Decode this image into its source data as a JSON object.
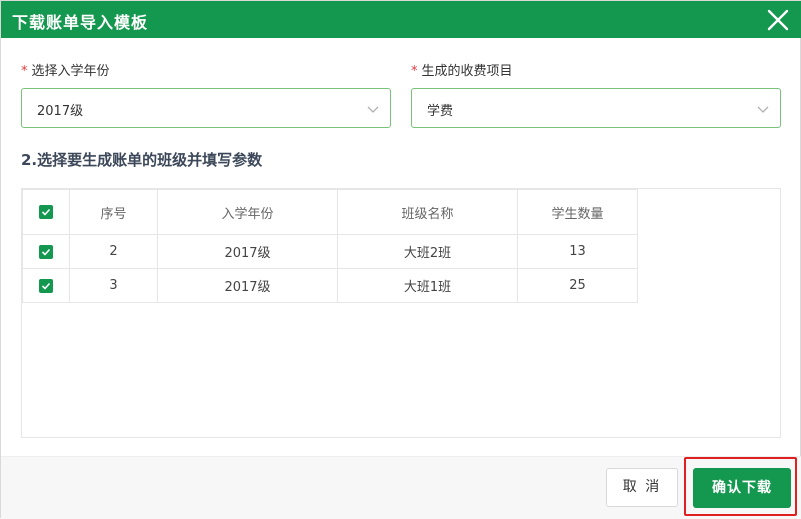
{
  "dialog": {
    "title": "下载账单导入模板",
    "close_icon": "close-icon"
  },
  "form": {
    "enroll_year": {
      "required_mark": "*",
      "label": "选择入学年份",
      "value": "2017级"
    },
    "fee_item": {
      "required_mark": "*",
      "label": "生成的收费项目",
      "value": "学费"
    }
  },
  "section_title": "2.选择要生成账单的班级并填写参数",
  "table": {
    "headers": [
      "序号",
      "入学年份",
      "班级名称",
      "学生数量"
    ],
    "rows": [
      {
        "checked": true,
        "no": "2",
        "year": "2017级",
        "class_name": "大班2班",
        "count": "13"
      },
      {
        "checked": true,
        "no": "3",
        "year": "2017级",
        "class_name": "大班1班",
        "count": "25"
      }
    ],
    "select_all_checked": true
  },
  "footer": {
    "cancel_label": "取 消",
    "confirm_label": "确认下载"
  },
  "colors": {
    "accent": "#14984f",
    "select_border": "#7ac27a",
    "highlight": "#e02020",
    "required": "#e4393c"
  }
}
